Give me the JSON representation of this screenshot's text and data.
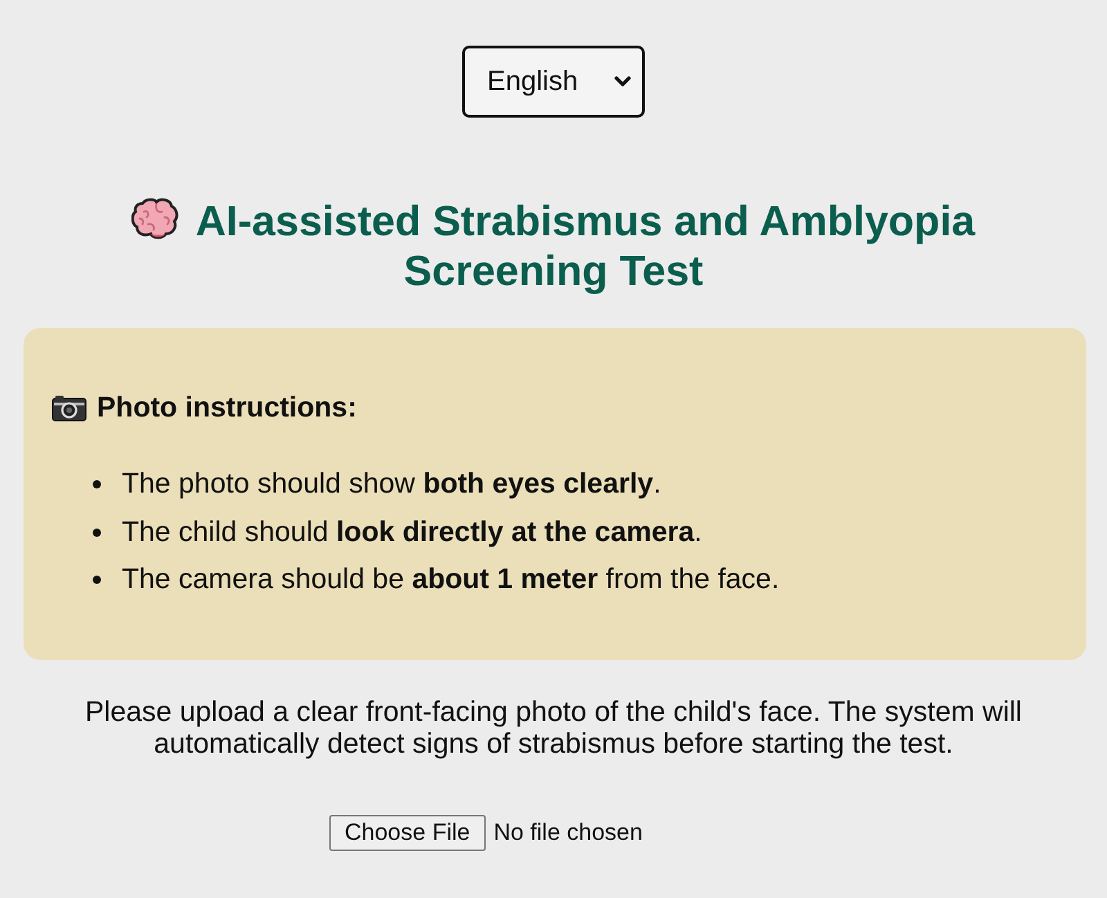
{
  "language_select": {
    "value": "English"
  },
  "title": "AI-assisted Strabismus and Amblyopia Screening Test",
  "instructions": {
    "heading": "Photo instructions:",
    "items": [
      "The photo should show **both eyes clearly**.",
      "The child should **look directly at the camera**.",
      "The camera should be **about 1 meter** from the face."
    ]
  },
  "description": "Please upload a clear front-facing photo of the child's face. The system will automatically detect signs of strabismus before starting the test.",
  "file_input": {
    "button": "Choose File",
    "status": "No file chosen"
  }
}
